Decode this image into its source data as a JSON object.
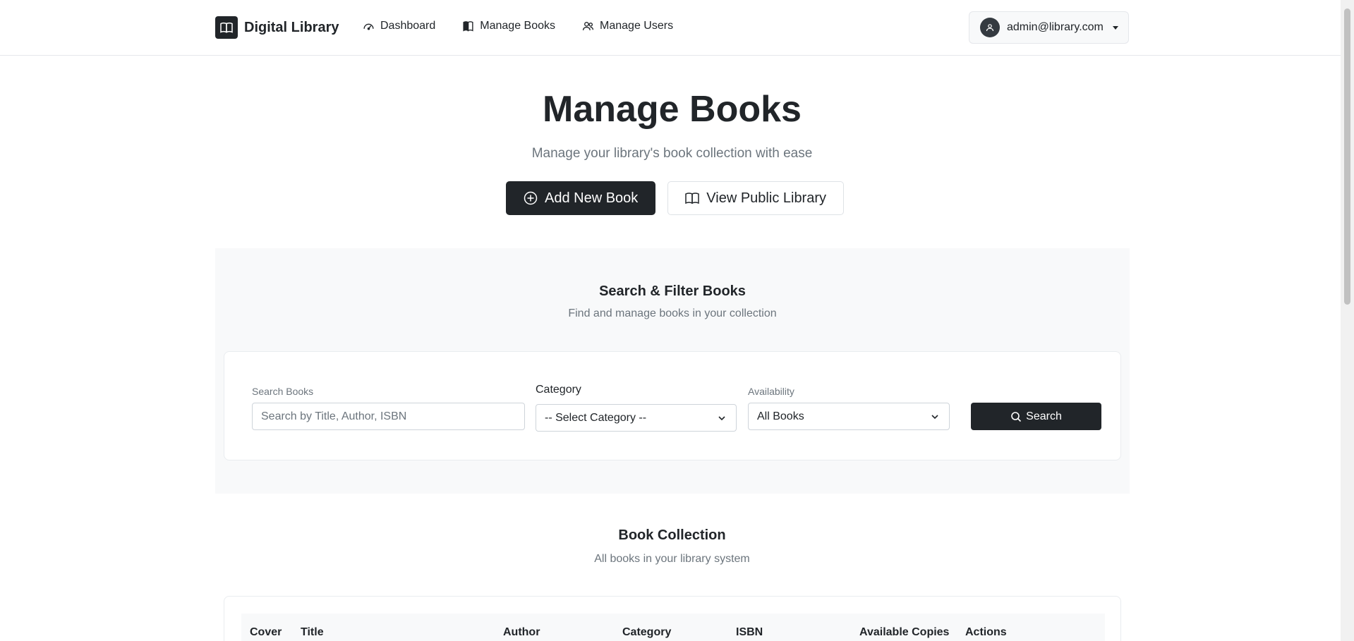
{
  "brand": {
    "name": "Digital Library",
    "icon": "book-open-icon"
  },
  "nav": {
    "items": [
      {
        "label": "Dashboard",
        "icon": "speedometer-icon"
      },
      {
        "label": "Manage Books",
        "icon": "book-icon"
      },
      {
        "label": "Manage Users",
        "icon": "people-icon"
      }
    ]
  },
  "user": {
    "email": "admin@library.com",
    "icon": "person-icon"
  },
  "hero": {
    "title": "Manage Books",
    "subtitle": "Manage your library's book collection with ease",
    "add_button": "Add New Book",
    "view_button": "View Public Library"
  },
  "search_section": {
    "title": "Search & Filter Books",
    "subtitle": "Find and manage books in your collection",
    "search_label": "Search Books",
    "search_placeholder": "Search by Title, Author, ISBN",
    "category_label": "Category",
    "category_value": "-- Select Category --",
    "availability_label": "Availability",
    "availability_value": "All Books",
    "search_button": "Search"
  },
  "collection": {
    "title": "Book Collection",
    "subtitle": "All books in your library system",
    "columns": [
      "Cover",
      "Title",
      "Author",
      "Category",
      "ISBN",
      "Available Copies",
      "Actions"
    ]
  },
  "colors": {
    "primary_dark": "#212529",
    "muted": "#6c757d",
    "section_bg": "#f8f9fa"
  }
}
